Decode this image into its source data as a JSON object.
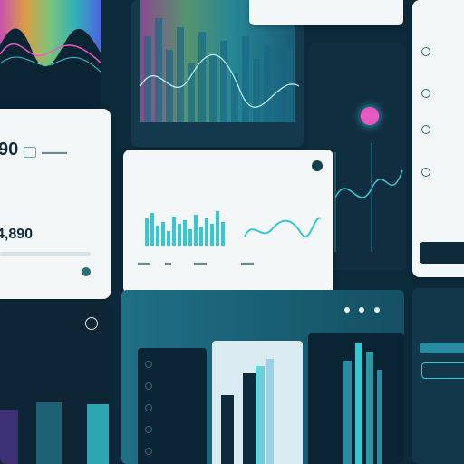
{
  "header": {
    "top_label": "",
    "top_right_label": ""
  },
  "left_top": {
    "title": "",
    "amount": "4,890"
  },
  "center_top": {
    "labels": [
      "",
      "",
      ""
    ]
  },
  "center_mid": {
    "title": "",
    "bar_label": "",
    "line_label": ""
  },
  "right_dark": {
    "label": ""
  },
  "far_right": {
    "title": "",
    "items": [
      "",
      "",
      "",
      ""
    ]
  },
  "bottom_center": {
    "title": "",
    "list_items": [
      "",
      "",
      "",
      "",
      "",
      ""
    ]
  },
  "bottom_right": {
    "title": "",
    "items": [
      "",
      "",
      "",
      ""
    ]
  },
  "colors": {
    "accent": "#37c7d1",
    "magenta": "#e85ac3",
    "dark_panel": "#0e2a3b",
    "light_panel": "#f4f7f8"
  },
  "icons": [
    "circle-icon",
    "record-icon",
    "check-icon",
    "settings-icon"
  ]
}
